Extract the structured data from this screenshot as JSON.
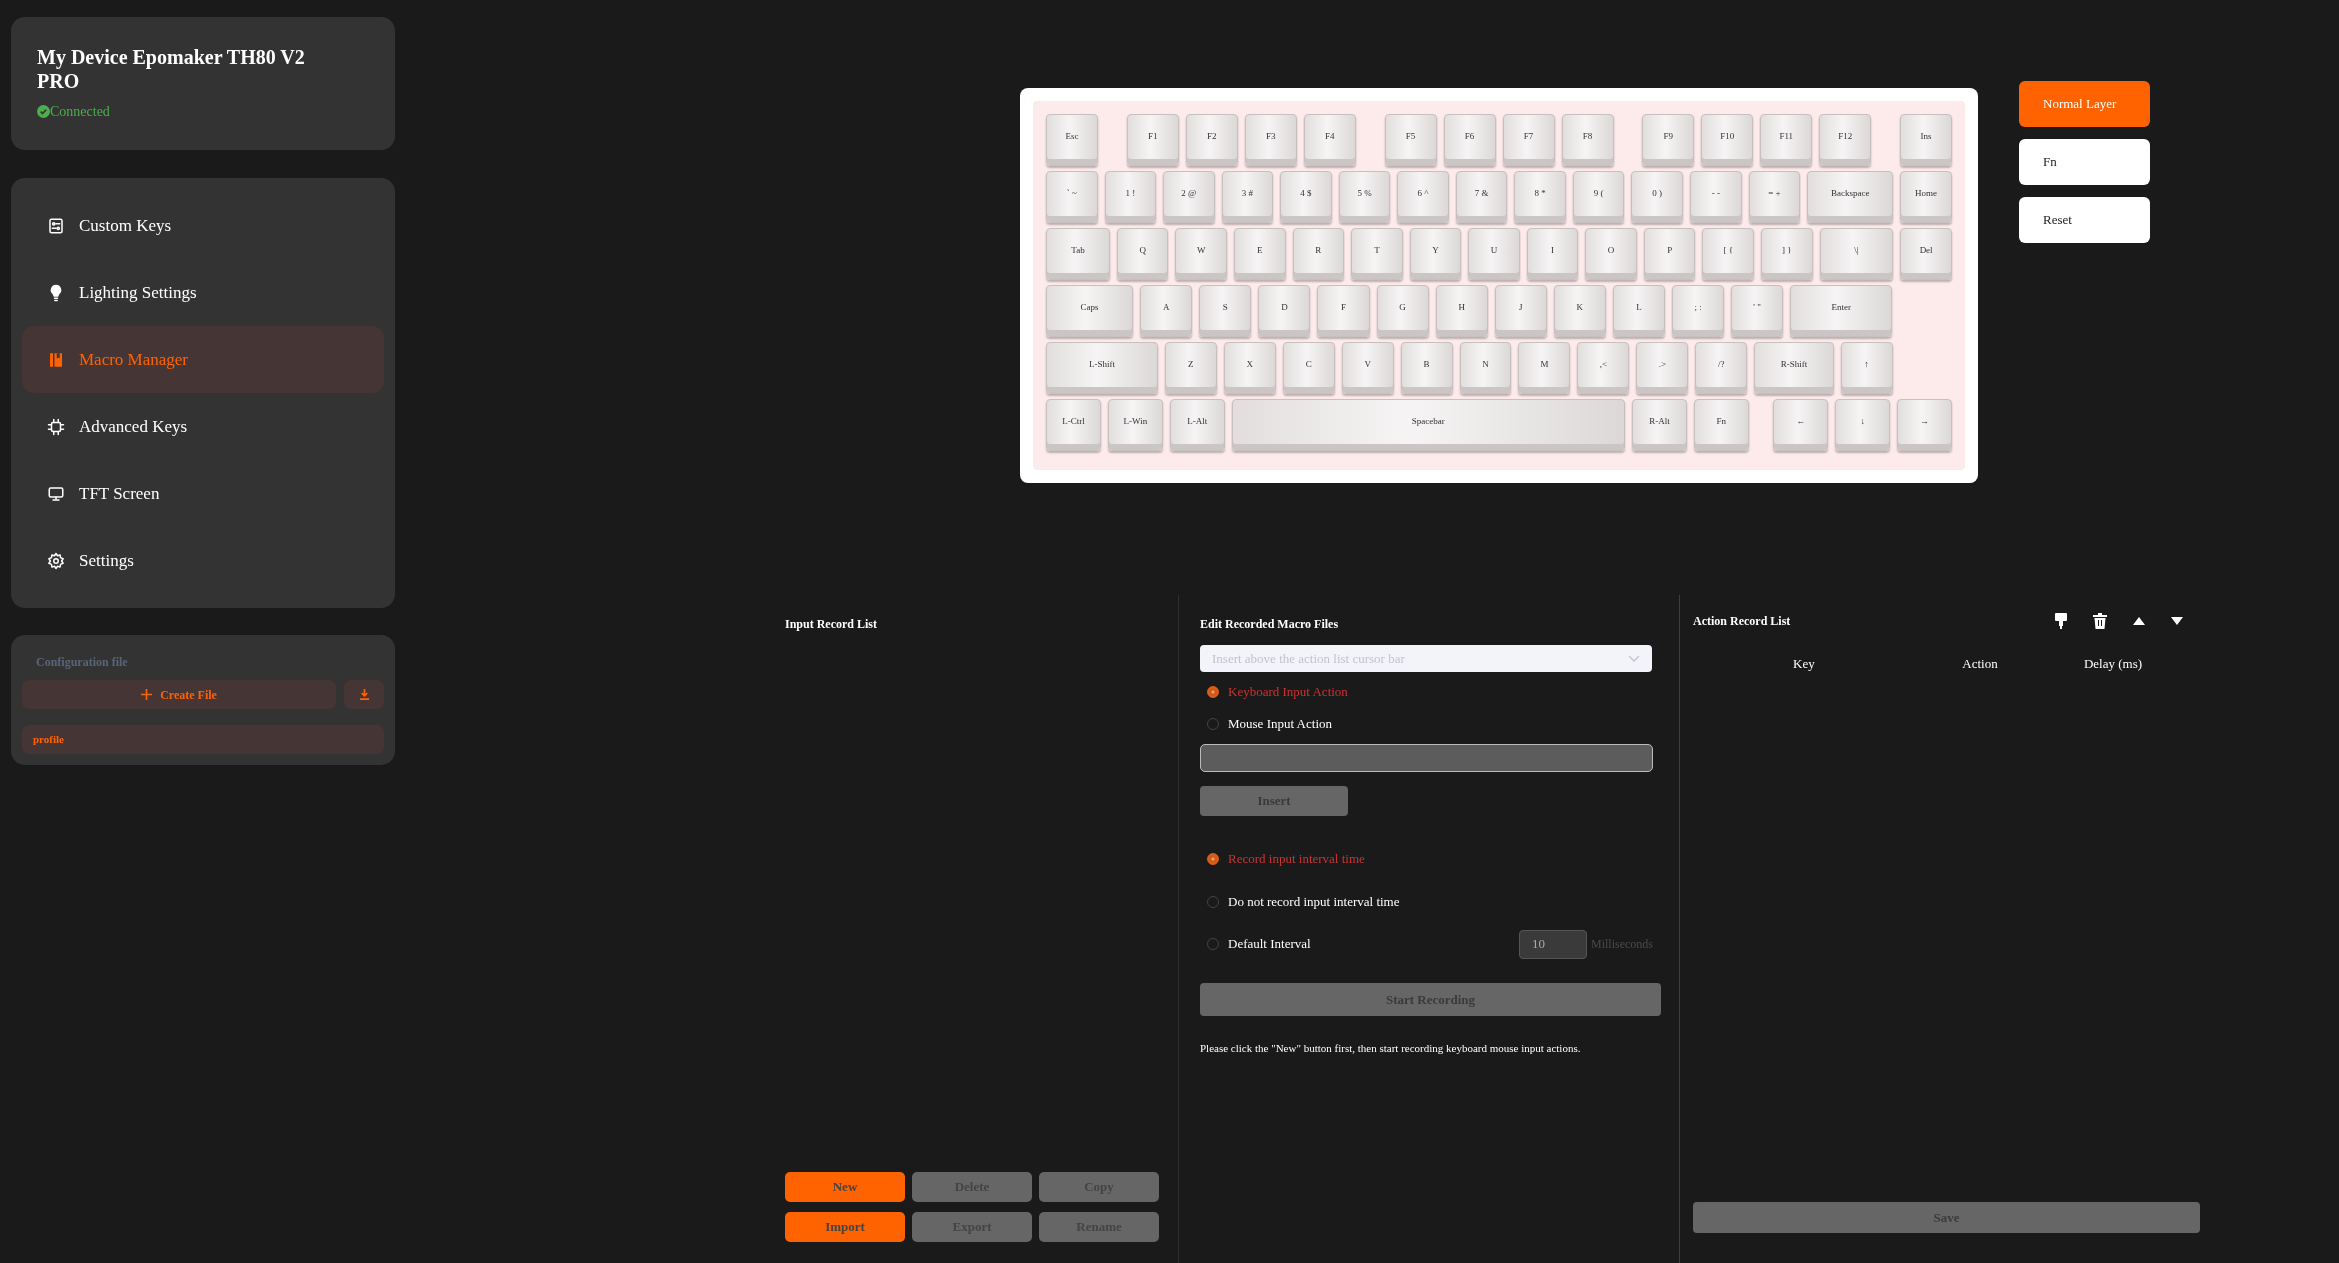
{
  "sidebar": {
    "device": {
      "title": "My Device Epomaker TH80 V2 PRO",
      "status": "Connected"
    },
    "nav": [
      {
        "label": "Custom Keys",
        "selected": false
      },
      {
        "label": "Lighting Settings",
        "selected": false
      },
      {
        "label": "Macro Manager",
        "selected": true
      },
      {
        "label": "Advanced Keys",
        "selected": false
      },
      {
        "label": "TFT Screen",
        "selected": false
      },
      {
        "label": "Settings",
        "selected": false
      }
    ],
    "config": {
      "title": "Configuration file",
      "create_button": "Create File",
      "files": [
        {
          "label": "profile"
        }
      ]
    }
  },
  "keyboard": {
    "rows": [
      {
        "keys": [
          "Esc",
          "F1",
          "F2",
          "F3",
          "F4",
          "F5",
          "F6",
          "F7",
          "F8",
          "F9",
          "F10",
          "F11",
          "F12",
          "Ins"
        ]
      },
      {
        "keys": [
          "` ~",
          "1 !",
          "2 @",
          "3 #",
          "4 $",
          "5 %",
          "6 ^",
          "7 &",
          "8 *",
          "9 (",
          "0 )",
          "- -",
          "= +",
          "Backspace",
          "Home"
        ]
      },
      {
        "keys": [
          "Tab",
          "Q",
          "W",
          "E",
          "R",
          "T",
          "Y",
          "U",
          "I",
          "O",
          "P",
          "[ {",
          "] }",
          "\\|",
          "Del"
        ]
      },
      {
        "keys": [
          "Caps",
          "A",
          "S",
          "D",
          "F",
          "G",
          "H",
          "J",
          "K",
          "L",
          "; :",
          "' \"",
          "Enter"
        ]
      },
      {
        "keys": [
          "L-Shift",
          "Z",
          "X",
          "C",
          "V",
          "B",
          "N",
          "M",
          ",<",
          ".>",
          "/?",
          "R-Shift",
          "↑"
        ]
      },
      {
        "keys": [
          "L-Ctrl",
          "L-Win",
          "L-Alt",
          "Spacebar",
          "R-Alt",
          "Fn",
          "←",
          "↓",
          "→"
        ]
      }
    ]
  },
  "layers": [
    {
      "label": "Normal Layer",
      "selected": true
    },
    {
      "label": "Fn",
      "selected": false
    }
  ],
  "reset_button": "Reset",
  "input_record": {
    "title": "Input Record List",
    "buttons": [
      {
        "label": "New",
        "disabled": false
      },
      {
        "label": "Delete",
        "disabled": true
      },
      {
        "label": "Copy",
        "disabled": true
      },
      {
        "label": "Import",
        "disabled": false
      },
      {
        "label": "Export",
        "disabled": true
      },
      {
        "label": "Rename",
        "disabled": true
      }
    ]
  },
  "editor": {
    "title": "Edit Recorded Macro Files",
    "insert_position": {
      "placeholder": "Insert above the action list cursor bar"
    },
    "input_types": [
      {
        "label": "Keyboard Input Action",
        "selected": true
      },
      {
        "label": "Mouse Input Action",
        "selected": false
      }
    ],
    "insert_button": "Insert",
    "interval_options": [
      {
        "label": "Record input interval time",
        "selected": true
      },
      {
        "label": "Do not record input interval time",
        "selected": false
      },
      {
        "label": "Default Interval",
        "selected": false
      }
    ],
    "interval_value": "10",
    "interval_unit": "Milliseconds",
    "start_button": "Start Recording",
    "hint": "Please click the \"New\" button first, then start recording keyboard mouse input actions."
  },
  "action_record": {
    "title": "Action Record List",
    "columns": [
      "Key",
      "Action",
      "Delay (ms)"
    ],
    "save_button": "Save"
  }
}
